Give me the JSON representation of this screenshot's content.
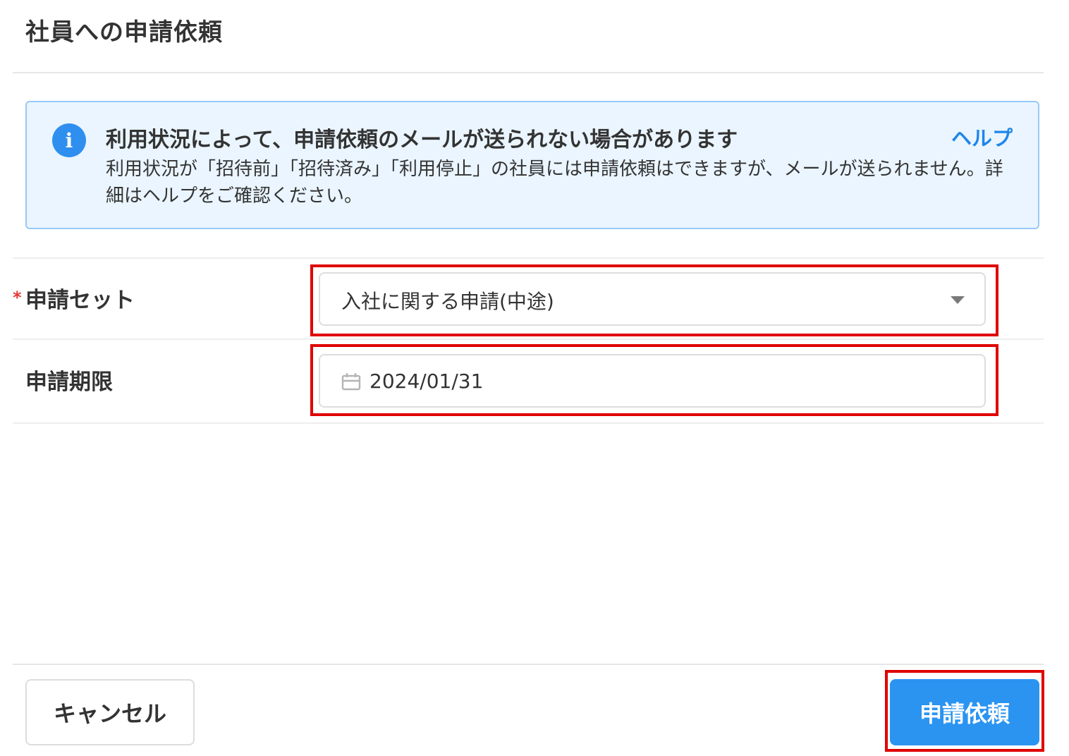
{
  "modal": {
    "title": "社員への申請依頼"
  },
  "info": {
    "icon": "info-icon",
    "icon_glyph": "i",
    "heading": "利用状況によって、申請依頼のメールが送られない場合があります",
    "help_link": "ヘルプ",
    "body": "利用状況が「招待前」「招待済み」「利用停止」の社員には申請依頼はできますが、メールが送られません。詳細はヘルプをご確認ください。",
    "accent_color": "#2f8fef"
  },
  "form": {
    "application_set": {
      "required_mark": "*",
      "label": "申請セット",
      "selected_value": "入社に関する申請(中途)",
      "caret_icon": "caret-down-icon"
    },
    "deadline": {
      "label": "申請期限",
      "value": "2024/01/31",
      "icon": "calendar-icon"
    }
  },
  "footer": {
    "cancel_label": "キャンセル",
    "submit_label": "申請依頼"
  },
  "colors": {
    "primary": "#2b94f1",
    "highlight": "#e00000",
    "required": "#e53935"
  }
}
